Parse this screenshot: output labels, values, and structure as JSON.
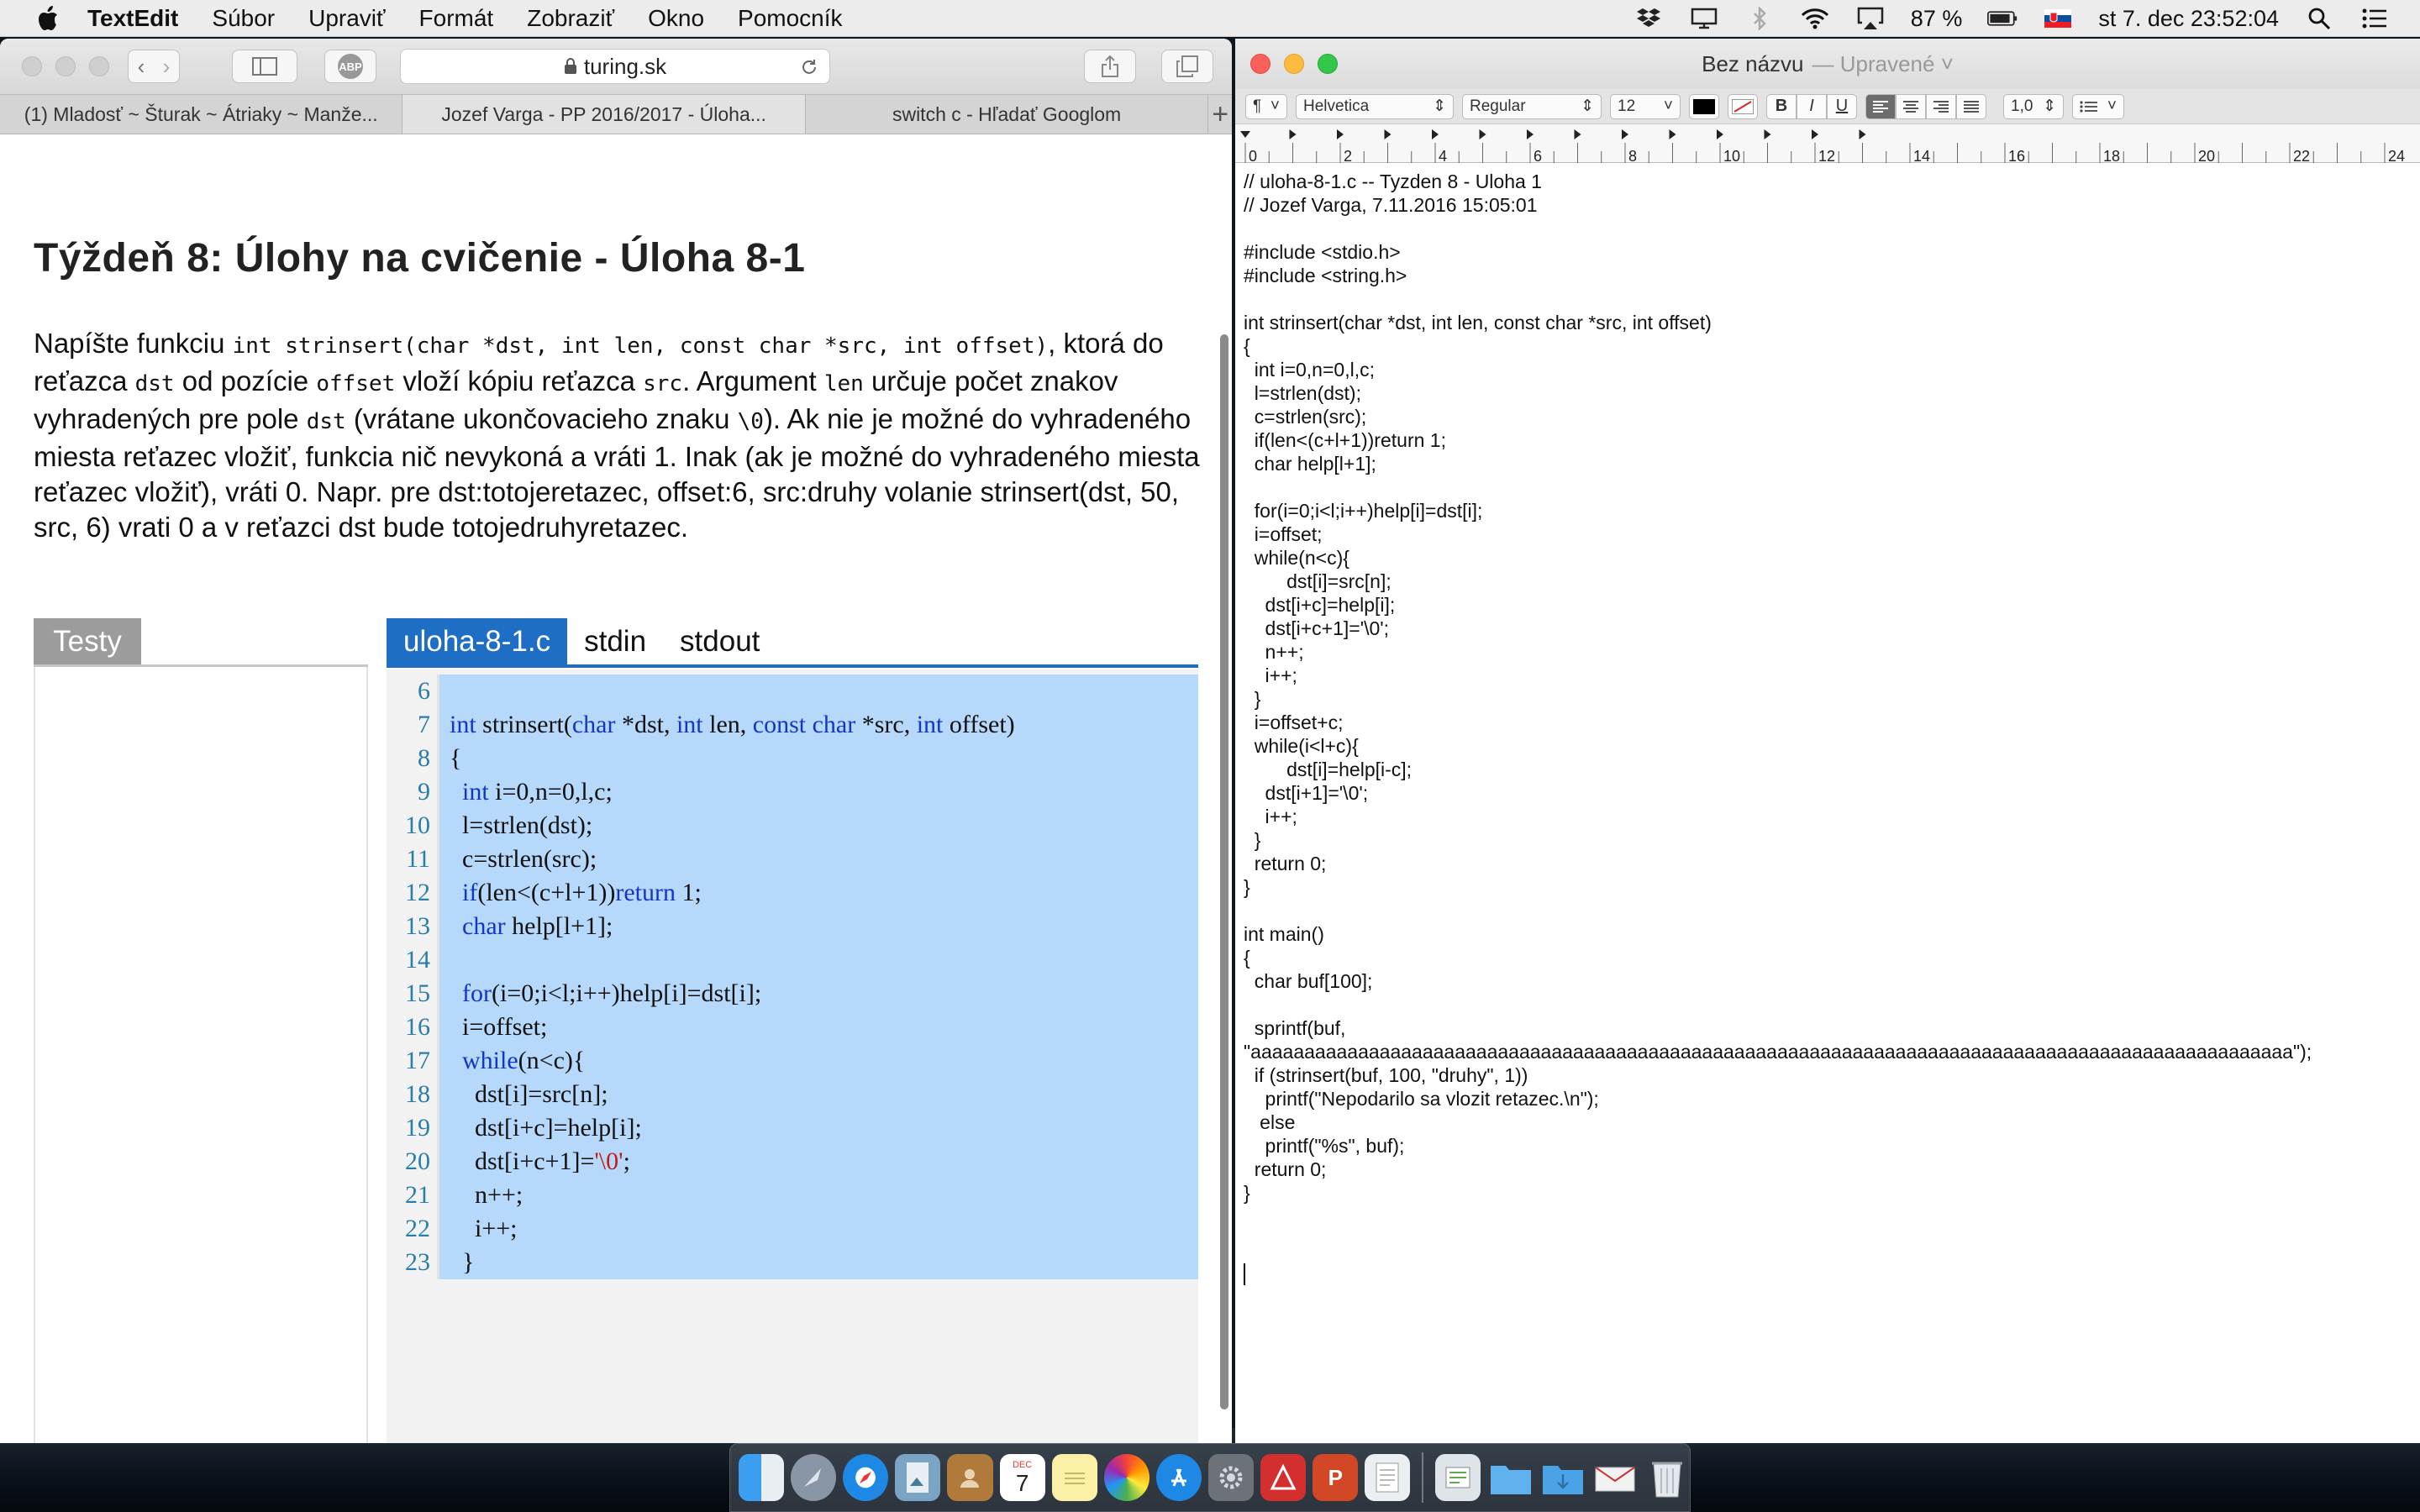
{
  "menubar": {
    "app_name": "TextEdit",
    "menus": [
      "Súbor",
      "Upraviť",
      "Formát",
      "Zobraziť",
      "Okno",
      "Pomocník"
    ],
    "battery": "87 %",
    "clock": "st 7. dec  23:52:04"
  },
  "safari": {
    "url": "turing.sk",
    "adblock_label": "ABP",
    "tabs": [
      "(1) Mladosť ~ Šturak ~ Átriaky ~ Manže...",
      "Jozef Varga - PP 2016/2017 - Úloha...",
      "switch c - Hľadať Googlom"
    ],
    "new_tab": "+",
    "page": {
      "title": "Týždeň 8: Úlohy na cvičenie - Úloha 8-1",
      "desc": [
        {
          "t": "Napíšte funkciu "
        },
        {
          "c": "int strinsert(char *dst, int len, const char *src, int offset)"
        },
        {
          "t": ", ktorá do reťazca "
        },
        {
          "c": "dst"
        },
        {
          "t": " od pozície "
        },
        {
          "c": "offset"
        },
        {
          "t": " vloží kópiu reťazca "
        },
        {
          "c": "src"
        },
        {
          "t": ". Argument "
        },
        {
          "c": "len"
        },
        {
          "t": " určuje počet znakov vyhradených pre pole "
        },
        {
          "c": "dst"
        },
        {
          "t": " (vrátane ukončovacieho znaku "
        },
        {
          "c": "\\0"
        },
        {
          "t": "). Ak nie je možné do vyhradeného miesta reťazec vložiť, funkcia nič nevykoná a vráti 1. Inak (ak je možné do vyhradeného miesta reťazec vložiť), vráti 0. Napr. pre dst:totojeretazec, offset:6, src:druhy volanie strinsert(dst, 50, src, 6) vrati 0 a v reťazci dst bude totojedruhyretazec."
        }
      ],
      "testy_label": "Testy",
      "editor_tabs": [
        "uloha-8-1.c",
        "stdin",
        "stdout"
      ],
      "code_lines": [
        {
          "n": "6",
          "code": ""
        },
        {
          "n": "7",
          "code": "int strinsert(char *dst, int len, const char *src, int offset)"
        },
        {
          "n": "8",
          "code": "{"
        },
        {
          "n": "9",
          "code": "  int i=0,n=0,l,c;"
        },
        {
          "n": "10",
          "code": "  l=strlen(dst);"
        },
        {
          "n": "11",
          "code": "  c=strlen(src);"
        },
        {
          "n": "12",
          "code": "  if(len<(c+l+1))return 1;"
        },
        {
          "n": "13",
          "code": "  char help[l+1];"
        },
        {
          "n": "14",
          "code": ""
        },
        {
          "n": "15",
          "code": "  for(i=0;i<l;i++)help[i]=dst[i];"
        },
        {
          "n": "16",
          "code": "  i=offset;"
        },
        {
          "n": "17",
          "code": "  while(n<c){"
        },
        {
          "n": "18",
          "code": "    dst[i]=src[n];"
        },
        {
          "n": "19",
          "code": "    dst[i+c]=help[i];"
        },
        {
          "n": "20",
          "code": "    dst[i+c+1]='\\0';"
        },
        {
          "n": "21",
          "code": "    n++;"
        },
        {
          "n": "22",
          "code": "    i++;"
        },
        {
          "n": "23",
          "code": "  }"
        }
      ]
    }
  },
  "textedit": {
    "doc_title": "Bez názvu",
    "doc_status": "— Upravené ˅",
    "toolbar": {
      "paragraph": "¶",
      "font": "Helvetica",
      "style": "Regular",
      "size": "12",
      "bold": "B",
      "italic": "I",
      "underline": "U",
      "spacing": "1,0"
    },
    "ruler_labels": [
      "0",
      "2",
      "4",
      "6",
      "8",
      "10",
      "12",
      "14",
      "16",
      "18",
      "20",
      "22",
      "24"
    ],
    "text_lines": [
      "// uloha-8-1.c -- Tyzden 8 - Uloha 1",
      "// Jozef Varga, 7.11.2016 15:05:01",
      "",
      "#include <stdio.h>",
      "#include <string.h>",
      "",
      "int strinsert(char *dst, int len, const char *src, int offset)",
      "{",
      "  int i=0,n=0,l,c;",
      "  l=strlen(dst);",
      "  c=strlen(src);",
      "  if(len<(c+l+1))return 1;",
      "  char help[l+1];",
      "",
      "  for(i=0;i<l;i++)help[i]=dst[i];",
      "  i=offset;",
      "  while(n<c){",
      "        dst[i]=src[n];",
      "    dst[i+c]=help[i];",
      "    dst[i+c+1]='\\0';",
      "    n++;",
      "    i++;",
      "  }",
      "  i=offset+c;",
      "  while(i<l+c){",
      "        dst[i]=help[i-c];",
      "    dst[i+1]='\\0';",
      "    i++;",
      "  }",
      "  return 0;",
      "}",
      "",
      "int main()",
      "{",
      "  char buf[100];",
      "",
      "  sprintf(buf,",
      "\"aaaaaaaaaaaaaaaaaaaaaaaaaaaaaaaaaaaaaaaaaaaaaaaaaaaaaaaaaaaaaaaaaaaaaaaaaaaaaaaaaaaaaaaaaaaaaaaaa\");",
      "  if (strinsert(buf, 100, \"druhy\", 1))",
      "    printf(\"Nepodarilo sa vlozit retazec.\\n\");",
      "   else",
      "    printf(\"%s\", buf);",
      "  return 0;",
      "}"
    ]
  },
  "dock": {
    "calendar_day": "7",
    "calendar_month": "DEC"
  }
}
